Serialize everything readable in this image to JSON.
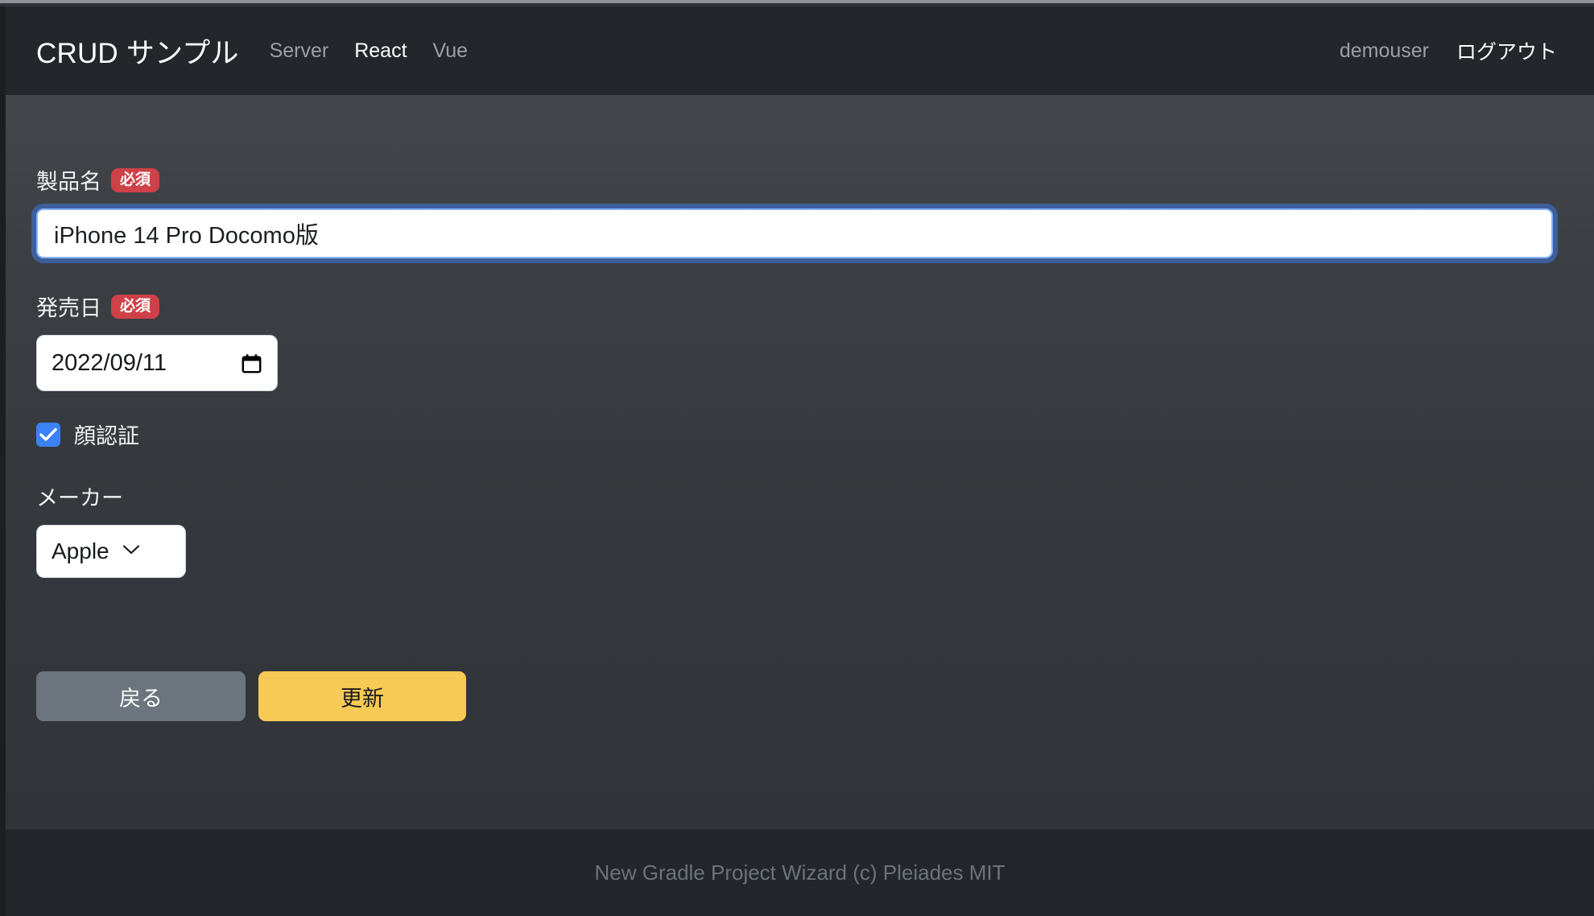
{
  "navbar": {
    "brand": "CRUD サンプル",
    "links": [
      {
        "label": "Server",
        "active": false
      },
      {
        "label": "React",
        "active": true
      },
      {
        "label": "Vue",
        "active": false
      }
    ],
    "user": "demouser",
    "logout": "ログアウト"
  },
  "form": {
    "product_name": {
      "label": "製品名",
      "required_badge": "必須",
      "value": "iPhone 14 Pro Docomo版",
      "placeholder": ""
    },
    "release_date": {
      "label": "発売日",
      "required_badge": "必須",
      "value": "2022/09/11",
      "icon": "calendar-icon"
    },
    "face_auth": {
      "label": "顔認証",
      "checked": true,
      "icon": "check-icon"
    },
    "maker": {
      "label": "メーカー",
      "value": "Apple",
      "options": [
        "Apple"
      ],
      "icon": "chevron-down-icon"
    },
    "buttons": {
      "back": "戻る",
      "update": "更新"
    }
  },
  "footer": {
    "text": "New Gradle Project Wizard (c) Pleiades MIT"
  },
  "colors": {
    "navbar_bg": "#23272b",
    "body_bg": "#3c4044",
    "footer_bg": "#23272b",
    "required_badge": "#cf4148",
    "checkbox_checked": "#3b82f6",
    "focus_ring": "#86b7fe",
    "btn_back": "#6c757d",
    "btn_update": "#f7ca55",
    "muted_text": "#9ba0a5"
  }
}
